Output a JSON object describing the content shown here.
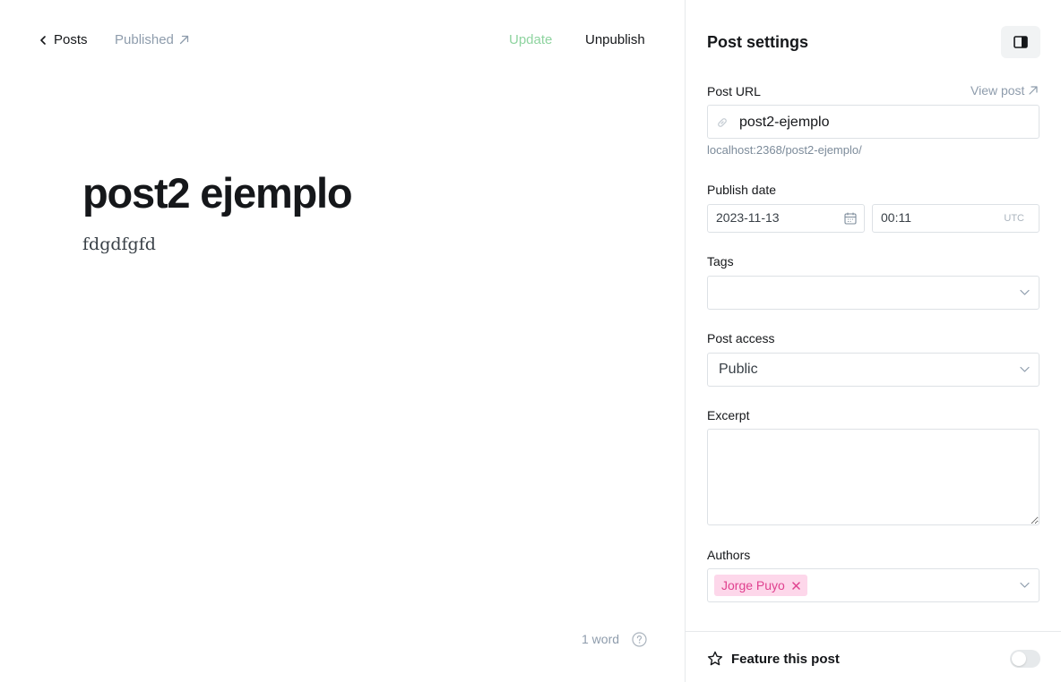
{
  "editor": {
    "back_label": "Posts",
    "status_label": "Published",
    "update_label": "Update",
    "unpublish_label": "Unpublish",
    "title": "post2 ejemplo",
    "body": "fdgdfgfd",
    "word_count": "1 word"
  },
  "settings": {
    "title": "Post settings",
    "post_url": {
      "label": "Post URL",
      "view_post_label": "View post",
      "value": "post2-ejemplo",
      "hint": "localhost:2368/post2-ejemplo/"
    },
    "publish_date": {
      "label": "Publish date",
      "date": "2023-11-13",
      "time": "00:11",
      "timezone": "UTC"
    },
    "tags": {
      "label": "Tags",
      "value": ""
    },
    "post_access": {
      "label": "Post access",
      "value": "Public"
    },
    "excerpt": {
      "label": "Excerpt",
      "value": ""
    },
    "authors": {
      "label": "Authors",
      "selected": [
        "Jorge Puyo"
      ]
    },
    "feature": {
      "label": "Feature this post",
      "enabled": false
    }
  },
  "colors": {
    "update_accent": "#8fd4a0",
    "author_chip_bg": "#fdd7ea",
    "author_chip_text": "#e0418f",
    "muted_text": "#8e9cac"
  },
  "icons": [
    "chevron-left-icon",
    "arrow-up-right-icon",
    "help-circle-icon",
    "sidebar-toggle-icon",
    "link-icon",
    "calendar-icon",
    "chevron-down-icon",
    "close-icon",
    "star-icon"
  ]
}
